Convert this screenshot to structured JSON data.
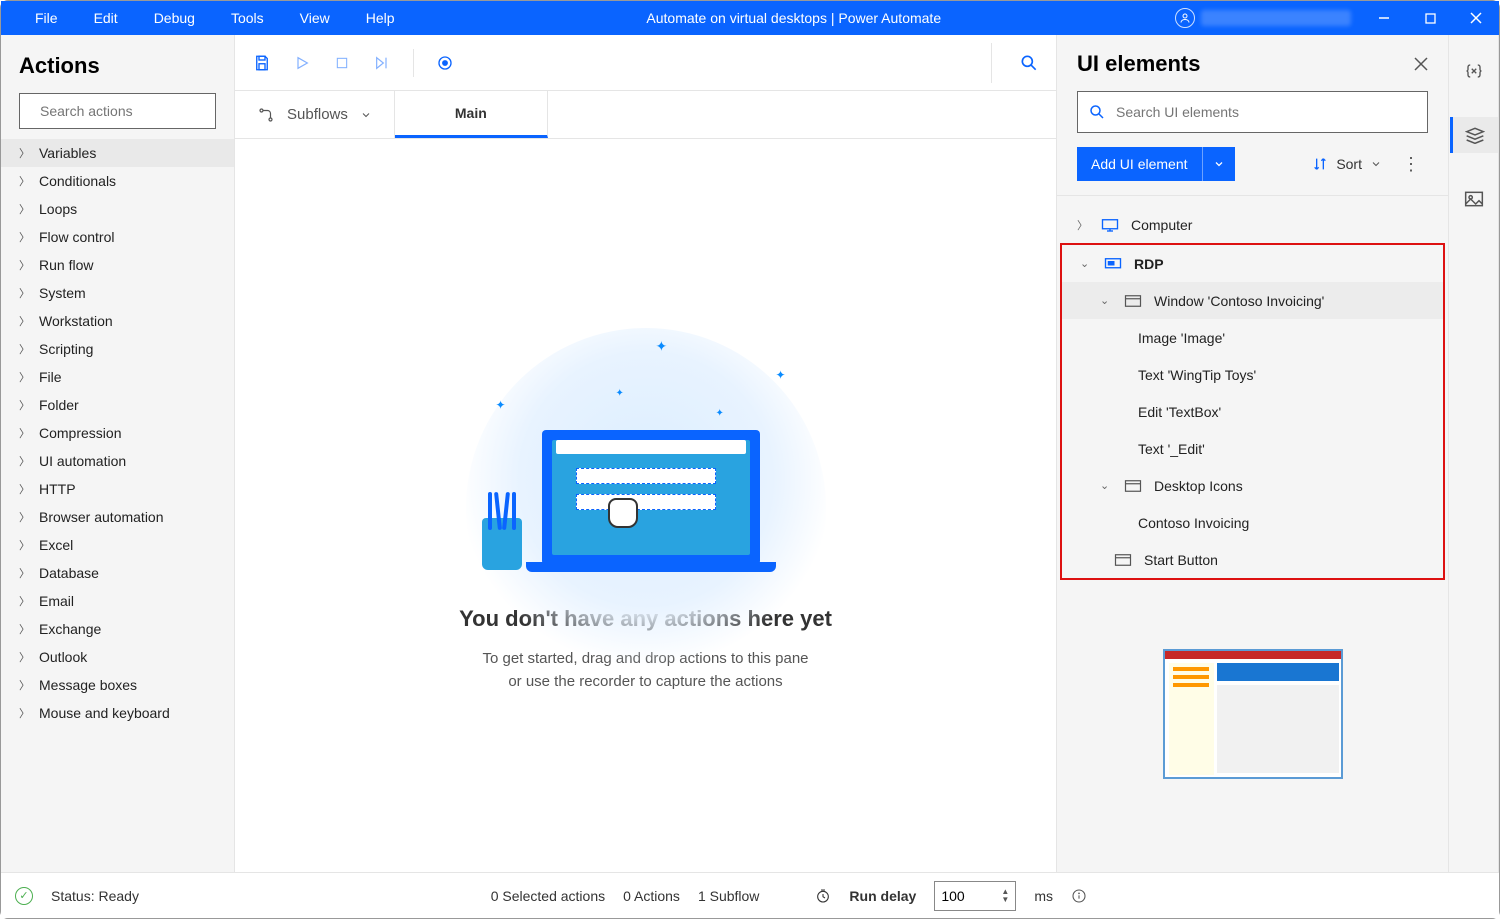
{
  "titlebar": {
    "menus": [
      "File",
      "Edit",
      "Debug",
      "Tools",
      "View",
      "Help"
    ],
    "title": "Automate on virtual desktops | Power Automate"
  },
  "actions": {
    "heading": "Actions",
    "search_placeholder": "Search actions",
    "categories": [
      "Variables",
      "Conditionals",
      "Loops",
      "Flow control",
      "Run flow",
      "System",
      "Workstation",
      "Scripting",
      "File",
      "Folder",
      "Compression",
      "UI automation",
      "HTTP",
      "Browser automation",
      "Excel",
      "Database",
      "Email",
      "Exchange",
      "Outlook",
      "Message boxes",
      "Mouse and keyboard"
    ]
  },
  "center": {
    "subflows_label": "Subflows",
    "tab_main": "Main",
    "empty_heading": "You don't have any actions here yet",
    "empty_body": "To get started, drag and drop actions to this pane\nor use the recorder to capture the actions"
  },
  "right": {
    "heading": "UI elements",
    "search_placeholder": "Search UI elements",
    "add_label": "Add UI element",
    "sort_label": "Sort",
    "tree": {
      "computer": "Computer",
      "rdp": "RDP",
      "window": "Window 'Contoso Invoicing'",
      "items": [
        "Image 'Image'",
        "Text 'WingTip Toys'",
        "Edit 'TextBox'",
        "Text '_Edit'"
      ],
      "desktop_icons": "Desktop Icons",
      "contoso": "Contoso Invoicing",
      "start": "Start Button"
    }
  },
  "status": {
    "ready": "Status: Ready",
    "selected": "0 Selected actions",
    "actions": "0 Actions",
    "subflows": "1 Subflow",
    "delay_label": "Run delay",
    "delay_value": "100",
    "ms": "ms"
  }
}
